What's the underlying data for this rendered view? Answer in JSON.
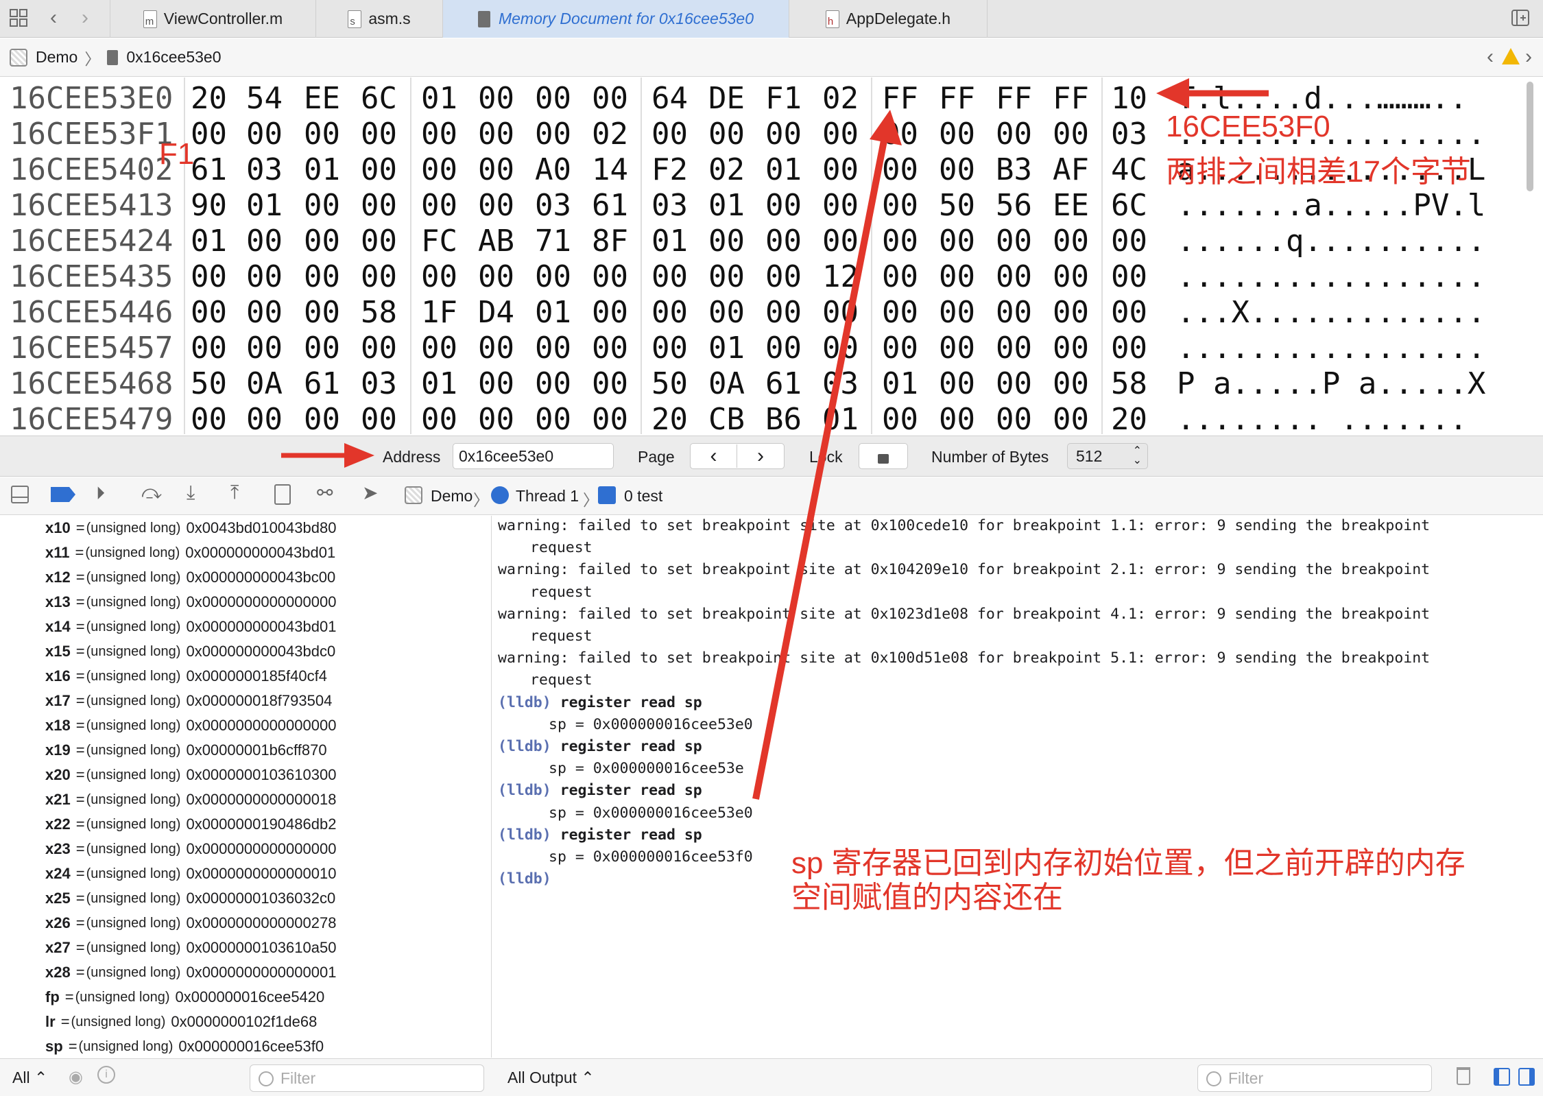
{
  "tabs": [
    {
      "label": "ViewController.m",
      "icon": "m"
    },
    {
      "label": "asm.s",
      "icon": "s"
    },
    {
      "label": "Memory Document for 0x16cee53e0",
      "icon": "memory-icon"
    },
    {
      "label": "AppDelegate.h",
      "icon": "h"
    }
  ],
  "jumpbar": {
    "project": "Demo",
    "address": "0x16cee53e0"
  },
  "hex_rows": [
    {
      "addr": "16CEE53E0",
      "bytes": [
        "20",
        "54",
        "EE",
        "6C",
        "01",
        "00",
        "00",
        "00",
        "64",
        "DE",
        "F1",
        "02",
        "FF",
        "FF",
        "FF",
        "FF",
        "10"
      ],
      "ascii": "T.l....d...……….."
    },
    {
      "addr": "16CEE53F1",
      "bytes": [
        "00",
        "00",
        "00",
        "00",
        "00",
        "00",
        "00",
        "02",
        "00",
        "00",
        "00",
        "00",
        "00",
        "00",
        "00",
        "00",
        "03"
      ],
      "ascii": "................."
    },
    {
      "addr": "16CEE5402",
      "bytes": [
        "61",
        "03",
        "01",
        "00",
        "00",
        "00",
        "A0",
        "14",
        "F2",
        "02",
        "01",
        "00",
        "00",
        "00",
        "B3",
        "AF",
        "4C"
      ],
      "ascii": "a...............L"
    },
    {
      "addr": "16CEE5413",
      "bytes": [
        "90",
        "01",
        "00",
        "00",
        "00",
        "00",
        "03",
        "61",
        "03",
        "01",
        "00",
        "00",
        "00",
        "50",
        "56",
        "EE",
        "6C"
      ],
      "ascii": ".......a.....PV.l"
    },
    {
      "addr": "16CEE5424",
      "bytes": [
        "01",
        "00",
        "00",
        "00",
        "FC",
        "AB",
        "71",
        "8F",
        "01",
        "00",
        "00",
        "00",
        "00",
        "00",
        "00",
        "00",
        "00"
      ],
      "ascii": "......q.........."
    },
    {
      "addr": "16CEE5435",
      "bytes": [
        "00",
        "00",
        "00",
        "00",
        "00",
        "00",
        "00",
        "00",
        "00",
        "00",
        "00",
        "12",
        "00",
        "00",
        "00",
        "00",
        "00"
      ],
      "ascii": "................."
    },
    {
      "addr": "16CEE5446",
      "bytes": [
        "00",
        "00",
        "00",
        "58",
        "1F",
        "D4",
        "01",
        "00",
        "00",
        "00",
        "00",
        "00",
        "00",
        "00",
        "00",
        "00",
        "00"
      ],
      "ascii": "...X............."
    },
    {
      "addr": "16CEE5457",
      "bytes": [
        "00",
        "00",
        "00",
        "00",
        "00",
        "00",
        "00",
        "00",
        "00",
        "01",
        "00",
        "00",
        "00",
        "00",
        "00",
        "00",
        "00"
      ],
      "ascii": "................."
    },
    {
      "addr": "16CEE5468",
      "bytes": [
        "50",
        "0A",
        "61",
        "03",
        "01",
        "00",
        "00",
        "00",
        "50",
        "0A",
        "61",
        "03",
        "01",
        "00",
        "00",
        "00",
        "58"
      ],
      "ascii": "P a.....P a.....X"
    },
    {
      "addr": "16CEE5479",
      "bytes": [
        "00",
        "00",
        "00",
        "00",
        "00",
        "00",
        "00",
        "00",
        "20",
        "CB",
        "B6",
        "01",
        "00",
        "00",
        "00",
        "00",
        "20"
      ],
      "ascii": "........ ......."
    }
  ],
  "controls": {
    "address_label": "Address",
    "address_value": "0x16cee53e0",
    "page_label": "Page",
    "lock_label": "Lock",
    "bytes_label": "Number of Bytes",
    "bytes_value": "512"
  },
  "debug_bar": {
    "project": "Demo",
    "thread": "Thread 1",
    "frame": "0 test"
  },
  "registers": [
    {
      "name": "x10",
      "type": "(unsigned long)",
      "value": "0x0043bd010043bd80"
    },
    {
      "name": "x11",
      "type": "(unsigned long)",
      "value": "0x000000000043bd01"
    },
    {
      "name": "x12",
      "type": "(unsigned long)",
      "value": "0x000000000043bc00"
    },
    {
      "name": "x13",
      "type": "(unsigned long)",
      "value": "0x0000000000000000"
    },
    {
      "name": "x14",
      "type": "(unsigned long)",
      "value": "0x000000000043bd01"
    },
    {
      "name": "x15",
      "type": "(unsigned long)",
      "value": "0x000000000043bdc0"
    },
    {
      "name": "x16",
      "type": "(unsigned long)",
      "value": "0x0000000185f40cf4"
    },
    {
      "name": "x17",
      "type": "(unsigned long)",
      "value": "0x000000018f793504"
    },
    {
      "name": "x18",
      "type": "(unsigned long)",
      "value": "0x0000000000000000"
    },
    {
      "name": "x19",
      "type": "(unsigned long)",
      "value": "0x00000001b6cff870"
    },
    {
      "name": "x20",
      "type": "(unsigned long)",
      "value": "0x0000000103610300"
    },
    {
      "name": "x21",
      "type": "(unsigned long)",
      "value": "0x0000000000000018"
    },
    {
      "name": "x22",
      "type": "(unsigned long)",
      "value": "0x0000000190486db2"
    },
    {
      "name": "x23",
      "type": "(unsigned long)",
      "value": "0x0000000000000000"
    },
    {
      "name": "x24",
      "type": "(unsigned long)",
      "value": "0x0000000000000010"
    },
    {
      "name": "x25",
      "type": "(unsigned long)",
      "value": "0x00000001036032c0"
    },
    {
      "name": "x26",
      "type": "(unsigned long)",
      "value": "0x0000000000000278"
    },
    {
      "name": "x27",
      "type": "(unsigned long)",
      "value": "0x0000000103610a50"
    },
    {
      "name": "x28",
      "type": "(unsigned long)",
      "value": "0x0000000000000001"
    },
    {
      "name": "fp",
      "type": "(unsigned long)",
      "value": "0x000000016cee5420"
    },
    {
      "name": "lr",
      "type": "(unsigned long)",
      "value": "0x0000000102f1de68"
    },
    {
      "name": "sp",
      "type": "(unsigned long)",
      "value": "0x000000016cee53f0"
    }
  ],
  "console_lines": [
    {
      "prompt": "",
      "text": "warning: failed to set breakpoint site at 0x100cede10 for breakpoint 1.1: error: 9 sending the breakpoint",
      "indent": false
    },
    {
      "prompt": "",
      "text": "request",
      "indent": true
    },
    {
      "prompt": "",
      "text": "warning: failed to set breakpoint site at 0x104209e10 for breakpoint 2.1: error: 9 sending the breakpoint",
      "indent": false
    },
    {
      "prompt": "",
      "text": "request",
      "indent": true
    },
    {
      "prompt": "",
      "text": "warning: failed to set breakpoint site at 0x1023d1e08 for breakpoint 4.1: error: 9 sending the breakpoint",
      "indent": false
    },
    {
      "prompt": "",
      "text": "request",
      "indent": true
    },
    {
      "prompt": "",
      "text": "warning: failed to set breakpoint site at 0x100d51e08 for breakpoint 5.1: error: 9 sending the breakpoint",
      "indent": false
    },
    {
      "prompt": "",
      "text": "request",
      "indent": true
    },
    {
      "prompt": "(lldb)",
      "text": "register read sp",
      "indent": false
    },
    {
      "prompt": "",
      "text": "sp = 0x000000016cee53e0",
      "indent": true
    },
    {
      "prompt": "(lldb)",
      "text": "register read sp",
      "indent": false
    },
    {
      "prompt": "",
      "text": "sp = 0x000000016cee53e",
      "indent": true
    },
    {
      "prompt": "(lldb)",
      "text": "register read sp",
      "indent": false
    },
    {
      "prompt": "",
      "text": "sp = 0x000000016cee53e0",
      "indent": true
    },
    {
      "prompt": "(lldb)",
      "text": "register read sp",
      "indent": false
    },
    {
      "prompt": "",
      "text": "sp = 0x000000016cee53f0",
      "indent": true
    },
    {
      "prompt": "(lldb)",
      "text": "",
      "indent": false
    }
  ],
  "bottom": {
    "scope": "All",
    "filter_placeholder": "Filter",
    "output": "All Output",
    "console_filter_placeholder": "Filter"
  },
  "annotations": {
    "f1": "F1",
    "addr_note": "16CEE53F0",
    "diff_note": "两排之间相差17个字节",
    "sp_note_1": "sp 寄存器已回到内存初始位置，但之前开辟的内存",
    "sp_note_2": "空间赋值的内容还在"
  },
  "colors": {
    "accent": "#2f6fd1",
    "annotation_red": "#e2362a",
    "active_tab_bg": "#d3e1f3",
    "lldb_prompt": "#5a6fb0"
  }
}
